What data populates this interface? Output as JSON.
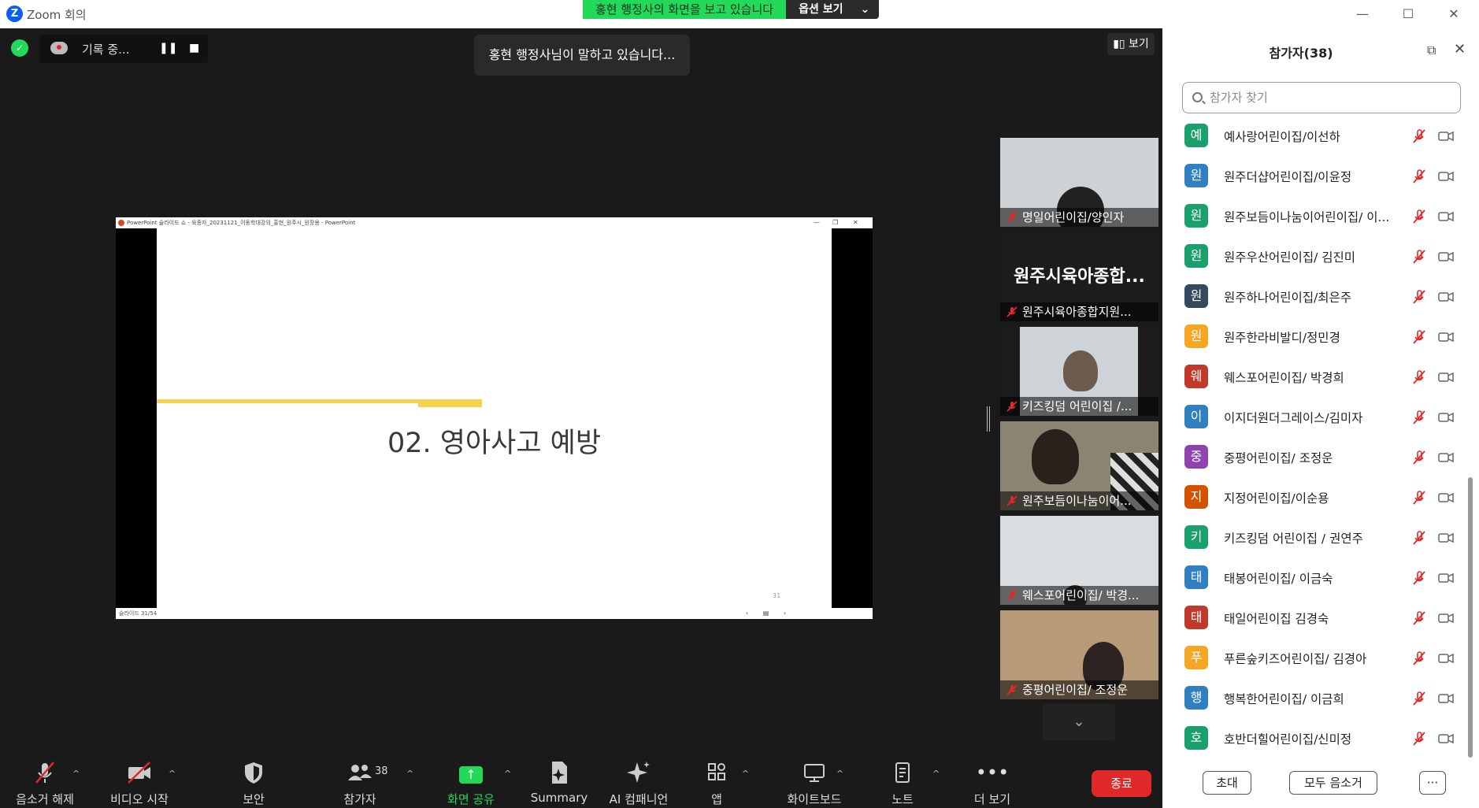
{
  "window": {
    "app_title": "Zoom 회의",
    "app_logo_letter": "Z"
  },
  "share_banner": {
    "message": "홍현 행정사의 화면을 보고 있습니다",
    "options_label": "옵션 보기",
    "options_caret": "⌄"
  },
  "window_controls": {
    "minimize": "—",
    "maximize": "☐",
    "close": "✕"
  },
  "meeting": {
    "shield_glyph": "✓",
    "recording_label": "기록 중...",
    "recording_pause": "❚❚",
    "recording_stop": "■",
    "speaker_toast": "홍현 행정사님이 말하고 있습니다...",
    "view_button": "보기"
  },
  "shared_screen": {
    "ppt_title": "PowerPoint 슬라이드 쇼  -  육종자_20231121_이동학대강의_홍현_원주시_원장용 - PowerPoint",
    "ppt_controls": [
      "—",
      "❐",
      "✕"
    ],
    "slide_heading": "02. 영아사고 예방",
    "slide_page_number": "31",
    "status_left": "슬라이드 31/54",
    "status_nav": "‹ ▤ ›"
  },
  "video_tiles": [
    {
      "name": "명일어린이집/양인자",
      "has_video": true
    },
    {
      "name": "원주시육아종합지원...",
      "has_video": false,
      "big_name": "원주시육아종합..."
    },
    {
      "name": "키즈킹덤 어린이집 /...",
      "has_video": true
    },
    {
      "name": "원주보듬이나눔이어...",
      "has_video": true
    },
    {
      "name": "웨스포어린이집/ 박경...",
      "has_video": true
    },
    {
      "name": "중평어린이집/ 조정운",
      "has_video": true
    }
  ],
  "video_scroll_glyph": "⌄",
  "toolbar": {
    "caret": "^",
    "unmute": {
      "label": "음소거 해제"
    },
    "start_video": {
      "label": "비디오 시작"
    },
    "security": {
      "label": "보안"
    },
    "participants": {
      "label": "참가자",
      "count": "38"
    },
    "share_screen": {
      "label": "화면 공유",
      "glyph": "↑"
    },
    "summary": {
      "label": "Summary"
    },
    "ai_companion": {
      "label": "AI 컴패니언"
    },
    "apps": {
      "label": "앱"
    },
    "whiteboard": {
      "label": "화이트보드"
    },
    "notes": {
      "label": "노트"
    },
    "more": {
      "label": "더 보기",
      "glyph": "•••"
    },
    "end": {
      "label": "종료"
    }
  },
  "participants_panel": {
    "title": "참가자(38)",
    "popout_glyph": "⧉",
    "close_glyph": "✕",
    "search_placeholder": "참가자 찾기",
    "participants": [
      {
        "initial": "예",
        "name": "예사랑어린이집/이선하",
        "color": "#1aa06d"
      },
      {
        "initial": "원",
        "name": "원주더샵어린이집/이윤정",
        "color": "#2f7fc1"
      },
      {
        "initial": "원",
        "name": "원주보듬이나눔이어린이집/ 이...",
        "color": "#1aa06d"
      },
      {
        "initial": "원",
        "name": "원주우산어린이집/ 김진미",
        "color": "#1aa06d"
      },
      {
        "initial": "원",
        "name": "원주하나어린이집/최은주",
        "color": "#34495e"
      },
      {
        "initial": "원",
        "name": "원주한라비발디/정민경",
        "color": "#f5a623"
      },
      {
        "initial": "웨",
        "name": "웨스포어린이집/ 박경희",
        "color": "#c0392b"
      },
      {
        "initial": "이",
        "name": "이지더원더그레이스/김미자",
        "color": "#2f7fc1"
      },
      {
        "initial": "중",
        "name": "중평어린이집/ 조정운",
        "color": "#8e44ad"
      },
      {
        "initial": "지",
        "name": "지정어린이집/이순용",
        "color": "#d35400"
      },
      {
        "initial": "키",
        "name": "키즈킹덤 어린이집 / 권연주",
        "color": "#1aa06d"
      },
      {
        "initial": "태",
        "name": "태봉어린이집/ 이금숙",
        "color": "#2f7fc1"
      },
      {
        "initial": "태",
        "name": "태일어린이집 김경숙",
        "color": "#c0392b"
      },
      {
        "initial": "푸",
        "name": "푸른숲키즈어린이집/ 김경아",
        "color": "#f5a623"
      },
      {
        "initial": "행",
        "name": "행복한어린이집/ 이금희",
        "color": "#2f7fc1"
      },
      {
        "initial": "호",
        "name": "호반더힐어린이집/신미정",
        "color": "#1aa06d"
      }
    ],
    "invite_label": "초대",
    "mute_all_label": "모두 음소거",
    "more_label": "···"
  }
}
